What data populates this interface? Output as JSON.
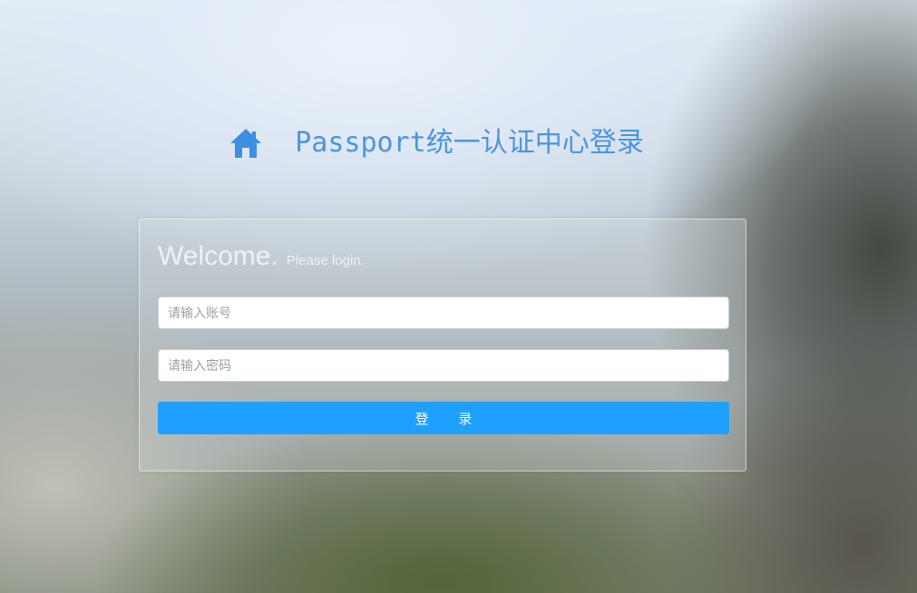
{
  "header": {
    "icon": "home-icon",
    "title": "Passport统一认证中心登录",
    "accent_color": "#4b95e2"
  },
  "login_panel": {
    "welcome": "Welcome.",
    "subtitle": "Please login.",
    "username": {
      "placeholder": "请输入账号",
      "value": ""
    },
    "password": {
      "placeholder": "请输入密码",
      "value": ""
    },
    "submit_label": "登 录",
    "button_color": "#1fa0ff"
  }
}
